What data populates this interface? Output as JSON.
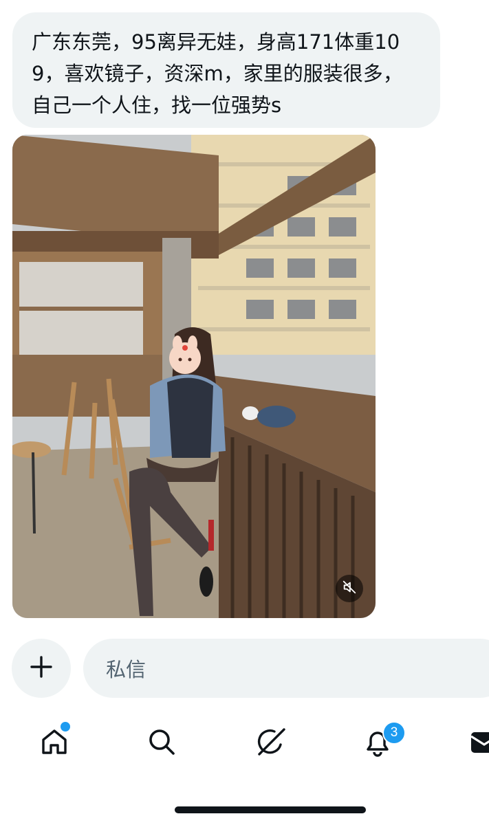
{
  "message": {
    "text": "广东东莞，95离异无娃，身高171体重109，喜欢镜子，资深m，家里的服装很多，自己一个人住，找一位强势s"
  },
  "attachment": {
    "type": "video",
    "mute_icon": "speaker-muted-icon"
  },
  "composer": {
    "add_icon": "plus-icon",
    "placeholder": "私信"
  },
  "tabbar": {
    "items": [
      {
        "name": "home",
        "icon": "home-icon",
        "has_dot": true
      },
      {
        "name": "search",
        "icon": "search-icon"
      },
      {
        "name": "grok",
        "icon": "grok-icon"
      },
      {
        "name": "notifications",
        "icon": "bell-icon",
        "badge": "3"
      },
      {
        "name": "messages",
        "icon": "envelope-icon"
      }
    ]
  },
  "colors": {
    "accent": "#1d9bf0",
    "bubble_bg": "#eff3f4",
    "text": "#0f1419",
    "placeholder": "#536471"
  }
}
